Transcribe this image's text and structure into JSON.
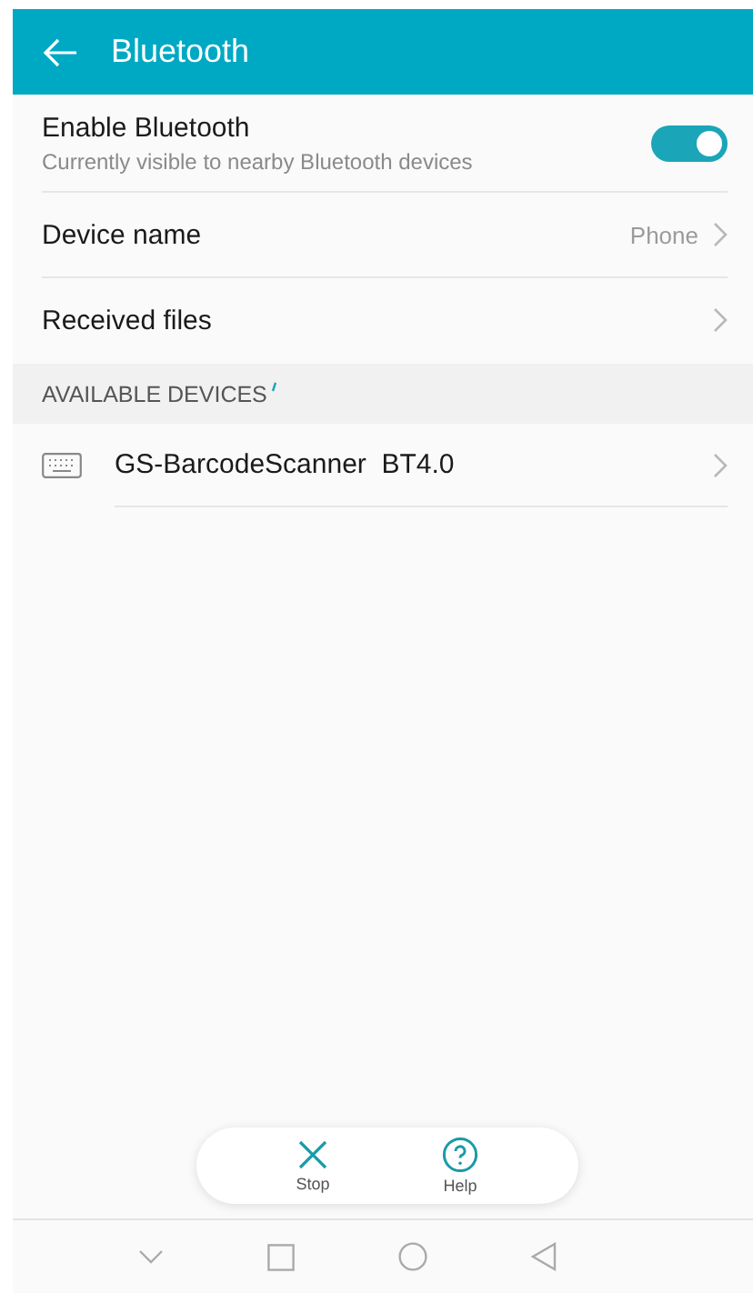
{
  "header": {
    "title": "Bluetooth"
  },
  "settings": [
    {
      "kind": "toggle",
      "label": "Enable Bluetooth",
      "subtitle": "Currently visible to nearby Bluetooth devices",
      "on": true
    },
    {
      "kind": "link",
      "label": "Device name",
      "value": "Phone"
    },
    {
      "kind": "link",
      "label": "Received files"
    }
  ],
  "available_devices": {
    "heading": "AVAILABLE DEVICES",
    "scanning": true,
    "devices": [
      {
        "name": "GS-BarcodeScanner  BT4.0"
      }
    ]
  },
  "actions": [
    {
      "kind": "stop",
      "label": "Stop"
    },
    {
      "kind": "help",
      "label": "Help"
    }
  ]
}
